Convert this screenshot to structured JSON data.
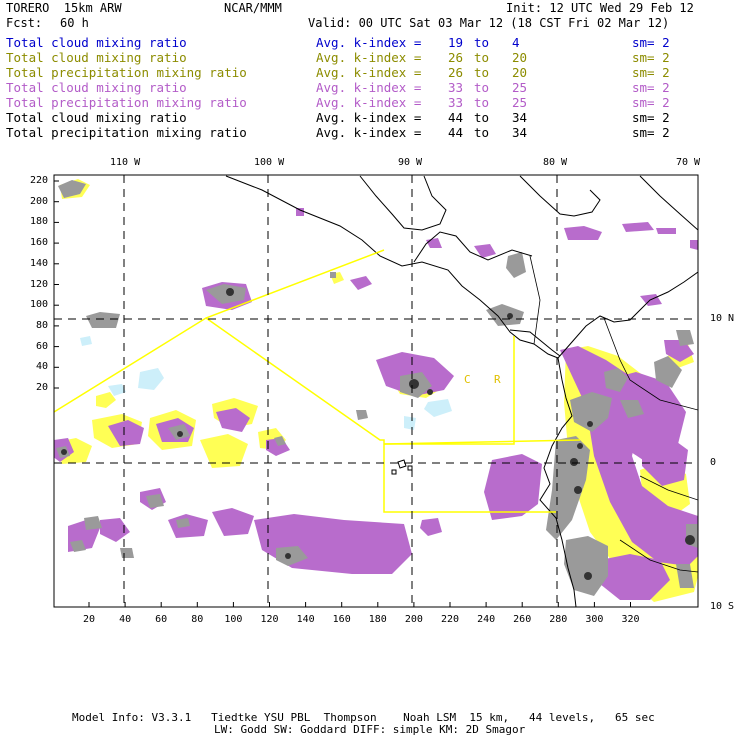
{
  "header": {
    "model_name": "TORERO  15km ARW",
    "org": "NCAR/MMM",
    "init": "Init: 12 UTC Wed 29 Feb 12",
    "fcst_label": "Fcst:",
    "fcst_value": "60 h",
    "valid": "Valid: 00 UTC Sat 03 Mar 12 (18 CST Fri 02 Mar 12)"
  },
  "legend": [
    {
      "field": "Total cloud mixing ratio",
      "index_label": "Avg. k-index =",
      "from": "19",
      "to_word": "to",
      "to": "4",
      "sm": "sm= 2",
      "color": "#0000cc"
    },
    {
      "field": "Total cloud mixing ratio",
      "index_label": "Avg. k-index =",
      "from": "26",
      "to_word": "to",
      "to": "20",
      "sm": "sm= 2",
      "color": "#8c8c00"
    },
    {
      "field": "Total precipitation mixing ratio",
      "index_label": "Avg. k-index =",
      "from": "26",
      "to_word": "to",
      "to": "20",
      "sm": "sm= 2",
      "color": "#8c8c00"
    },
    {
      "field": "Total cloud mixing ratio",
      "index_label": "Avg. k-index =",
      "from": "33",
      "to_word": "to",
      "to": "25",
      "sm": "sm= 2",
      "color": "#b35cc8"
    },
    {
      "field": "Total precipitation mixing ratio",
      "index_label": "Avg. k-index =",
      "from": "33",
      "to_word": "to",
      "to": "25",
      "sm": "sm= 2",
      "color": "#b35cc8"
    },
    {
      "field": "Total cloud mixing ratio",
      "index_label": "Avg. k-index =",
      "from": "44",
      "to_word": "to",
      "to": "34",
      "sm": "sm= 2",
      "color": "#000000"
    },
    {
      "field": "Total precipitation mixing ratio",
      "index_label": "Avg. k-index =",
      "from": "44",
      "to_word": "to",
      "to": "34",
      "sm": "sm= 2",
      "color": "#000000"
    }
  ],
  "map": {
    "top_lon_labels": [
      "110 W",
      "100 W",
      "90 W",
      "80 W",
      "70 W"
    ],
    "right_lat_labels": [
      "10 N",
      "0",
      "10 S"
    ],
    "left_ticks": [
      "220",
      "200",
      "180",
      "160",
      "140",
      "120",
      "100",
      "80",
      "60",
      "40",
      "20"
    ],
    "bottom_ticks": [
      "20",
      "40",
      "60",
      "80",
      "100",
      "120",
      "140",
      "160",
      "180",
      "200",
      "220",
      "240",
      "260",
      "280",
      "300",
      "320"
    ],
    "region_labels": [
      "C",
      "R"
    ],
    "colors": {
      "gray_cloud": "#9a9a9a",
      "purple_precip": "#b86ccc",
      "yellow_precip": "#ffff55",
      "cyan_cloud": "#cdeffa",
      "domain_box": "#ffff00"
    }
  },
  "footer": {
    "line1": "Model Info: V3.3.1   Tiedtke YSU PBL  Thompson    Noah LSM  15 km,   44 levels,   65 sec",
    "line2": "LW: Godd SW: Goddard DIFF: simple KM: 2D Smagor"
  }
}
